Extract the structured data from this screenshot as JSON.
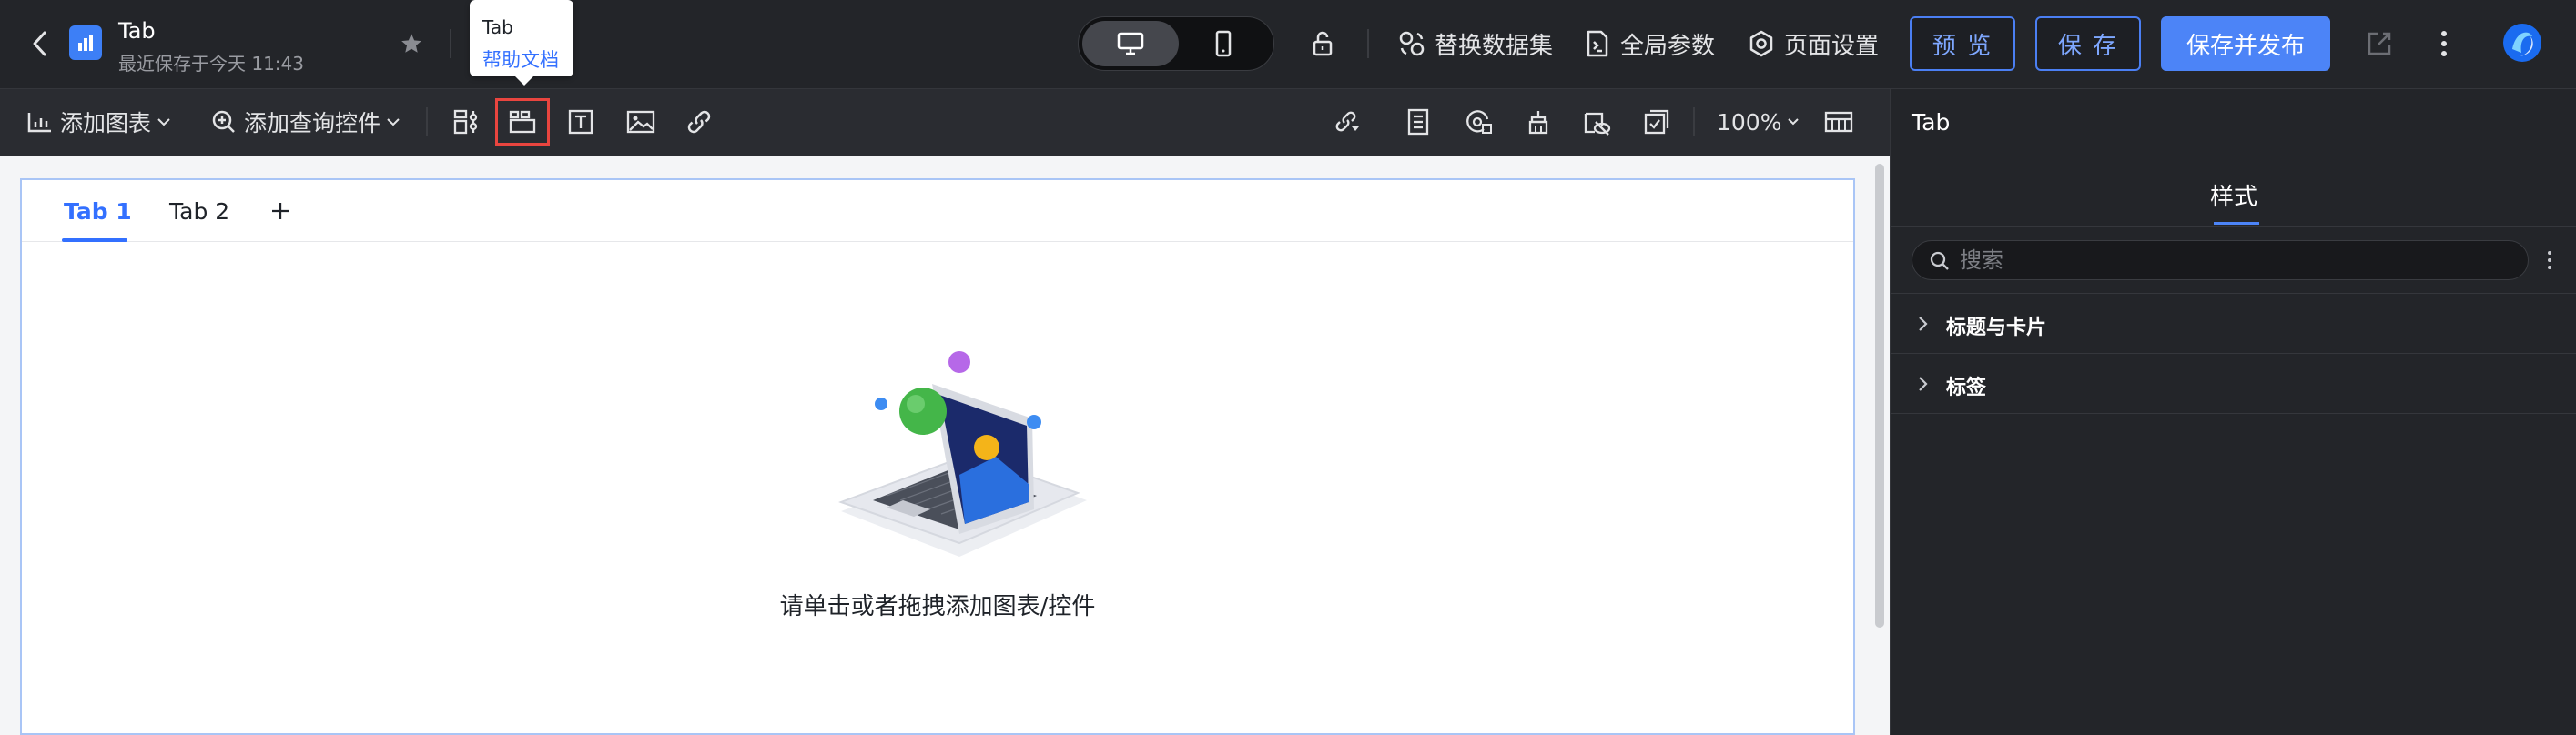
{
  "header": {
    "title": "Tab",
    "subtitle": "最近保存于今天 11:43",
    "actions": {
      "replace_dataset": "替换数据集",
      "global_params": "全局参数",
      "page_settings": "页面设置"
    },
    "buttons": {
      "preview": "预 览",
      "save": "保 存",
      "save_publish": "保存并发布"
    }
  },
  "tooltip": {
    "title": "Tab",
    "link": "帮助文档"
  },
  "toolbar": {
    "add_chart": "添加图表",
    "add_query": "添加查询控件",
    "zoom": "100%"
  },
  "canvas": {
    "tabs": [
      "Tab 1",
      "Tab 2"
    ],
    "empty_text": "请单击或者拖拽添加图表/控件"
  },
  "right_panel": {
    "title": "Tab",
    "tab": "样式",
    "search_placeholder": "搜索",
    "sections": [
      "标题与卡片",
      "标签"
    ]
  },
  "colors": {
    "accent": "#4c84f7",
    "highlight": "#e9453f",
    "active_tab": "#3370ff"
  }
}
